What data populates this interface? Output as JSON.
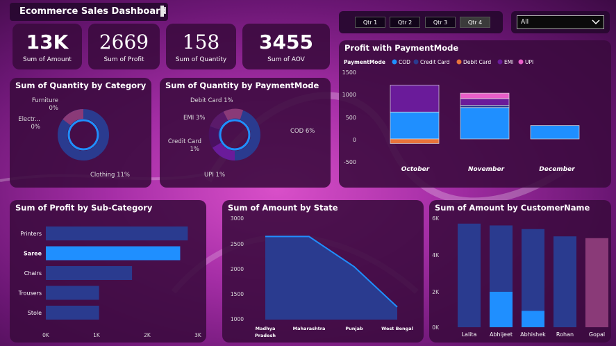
{
  "header": {
    "title": "Ecommerce Sales Dashboard"
  },
  "kpis": [
    {
      "value": "13K",
      "label": "Sum of Amount"
    },
    {
      "value": "2669",
      "label": "Sum of Profit"
    },
    {
      "value": "158",
      "label": "Sum of Quantity"
    },
    {
      "value": "3455",
      "label": "Sum of AOV"
    }
  ],
  "quarter_slicer": {
    "options": [
      "Qtr 1",
      "Qtr 2",
      "Qtr 3",
      "Qtr 4"
    ],
    "selected": "Qtr 4"
  },
  "filter_dropdown": {
    "value": "All"
  },
  "colors": {
    "bar_blue": "#1f8fff",
    "bar_dark": "#2a3b8f",
    "cod": "#1f8fff",
    "credit_card": "#2a3b8f",
    "debit_card": "#e8743b",
    "emi": "#6a1b9a",
    "upi": "#e85fc8"
  },
  "category_donut": {
    "title": "Sum of Quantity by Category",
    "labels": [
      "Furniture\n0%",
      "Electr...\n0%",
      "Clothing 11%"
    ],
    "label_furniture": "Furniture",
    "label_furniture_pct": "0%",
    "label_electr": "Electr...",
    "label_electr_pct": "0%",
    "label_clothing": "Clothing 11%"
  },
  "payment_donut": {
    "title": "Sum of Quantity by PaymentMode",
    "label_debit": "Debit Card 1%",
    "label_emi": "EMI 3%",
    "label_credit": "Credit Card",
    "label_credit_pct": "1%",
    "label_upi": "UPI 1%",
    "label_cod": "COD 6%"
  },
  "profit_payment": {
    "title": "Profit with PaymentMode",
    "legend_title": "PaymentMode",
    "legend": [
      "COD",
      "Credit Card",
      "Debit Card",
      "EMI",
      "UPI"
    ],
    "y_ticks": [
      "1500",
      "1000",
      "500",
      "0",
      "-500"
    ],
    "months": [
      "October",
      "November",
      "December"
    ]
  },
  "subcategory": {
    "title": "Sum of Profit by Sub-Category",
    "categories": [
      "Printers",
      "Saree",
      "Chairs",
      "Trousers",
      "Stole"
    ],
    "x_ticks": [
      "0K",
      "1K",
      "2K",
      "3K"
    ]
  },
  "state": {
    "title": "Sum of Amount by State",
    "y_ticks": [
      "3000",
      "2500",
      "2000",
      "1500",
      "1000"
    ],
    "x_labels": [
      "Madhya",
      "Maharashtra",
      "Punjab",
      "West Bengal"
    ],
    "x_label_madhya_2": "Pradesh"
  },
  "customer": {
    "title": "Sum of Amount by CustomerName",
    "y_ticks": [
      "6K",
      "4K",
      "2K",
      "0K"
    ],
    "names": [
      "Lalita",
      "Abhijeet",
      "Abhishek",
      "Rohan",
      "Gopal"
    ]
  },
  "chart_data": [
    {
      "type": "bar",
      "title": "Sum of Profit by Sub-Category",
      "orientation": "horizontal",
      "categories": [
        "Printers",
        "Saree",
        "Chairs",
        "Trousers",
        "Stole"
      ],
      "values": [
        2800,
        2650,
        1700,
        1050,
        1050
      ],
      "highlight": "Saree",
      "xlim": [
        0,
        3000
      ]
    },
    {
      "type": "area",
      "title": "Sum of Amount by State",
      "categories": [
        "Madhya Pradesh",
        "Maharashtra",
        "Punjab",
        "West Bengal"
      ],
      "values": [
        2650,
        2650,
        2050,
        1250
      ],
      "ylim": [
        1000,
        3000
      ]
    },
    {
      "type": "bar",
      "title": "Sum of Amount by CustomerName",
      "categories": [
        "Lalita",
        "Abhijeet",
        "Abhishek",
        "Rohan",
        "Gopal"
      ],
      "series": [
        {
          "values": [
            5700,
            5600,
            5400,
            5000,
            4900
          ]
        },
        {
          "values": [
            0,
            1950,
            900,
            0,
            0
          ]
        }
      ],
      "ylim": [
        0,
        6000
      ]
    },
    {
      "type": "bar",
      "title": "Profit with PaymentMode",
      "stacked": true,
      "categories": [
        "October",
        "November",
        "December"
      ],
      "series": [
        {
          "name": "COD",
          "values": [
            600,
            700,
            300
          ]
        },
        {
          "name": "Credit Card",
          "values": [
            0,
            50,
            0
          ]
        },
        {
          "name": "Debit Card",
          "values": [
            -100,
            0,
            0
          ]
        },
        {
          "name": "EMI",
          "values": [
            600,
            150,
            0
          ]
        },
        {
          "name": "UPI",
          "values": [
            0,
            120,
            0
          ]
        }
      ],
      "ylim": [
        -500,
        1500
      ]
    },
    {
      "type": "pie",
      "title": "Sum of Quantity by Category",
      "labels": [
        "Furniture",
        "Electronics",
        "Clothing"
      ],
      "values": [
        0.5,
        0.5,
        11
      ]
    },
    {
      "type": "pie",
      "title": "Sum of Quantity by PaymentMode",
      "labels": [
        "Debit Card",
        "EMI",
        "Credit Card",
        "UPI",
        "COD"
      ],
      "values": [
        1,
        3,
        1,
        1,
        6
      ]
    }
  ]
}
